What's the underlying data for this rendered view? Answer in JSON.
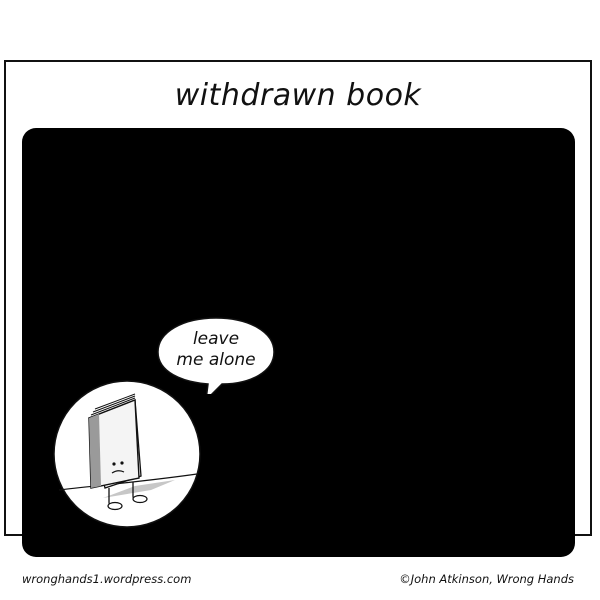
{
  "comic": {
    "title": "withdrawn book",
    "speech": {
      "line1": "leave",
      "line2": "me alone"
    },
    "footer": {
      "website": "wronghands1.wordpress.com",
      "credit": "©John Atkinson, Wrong Hands"
    },
    "colors": {
      "panel": "#000000",
      "ink": "#111111",
      "paper": "#ffffff",
      "shadow": "#bfbfbf"
    },
    "icons": [
      "sad-book-icon",
      "speech-bubble-icon"
    ]
  }
}
